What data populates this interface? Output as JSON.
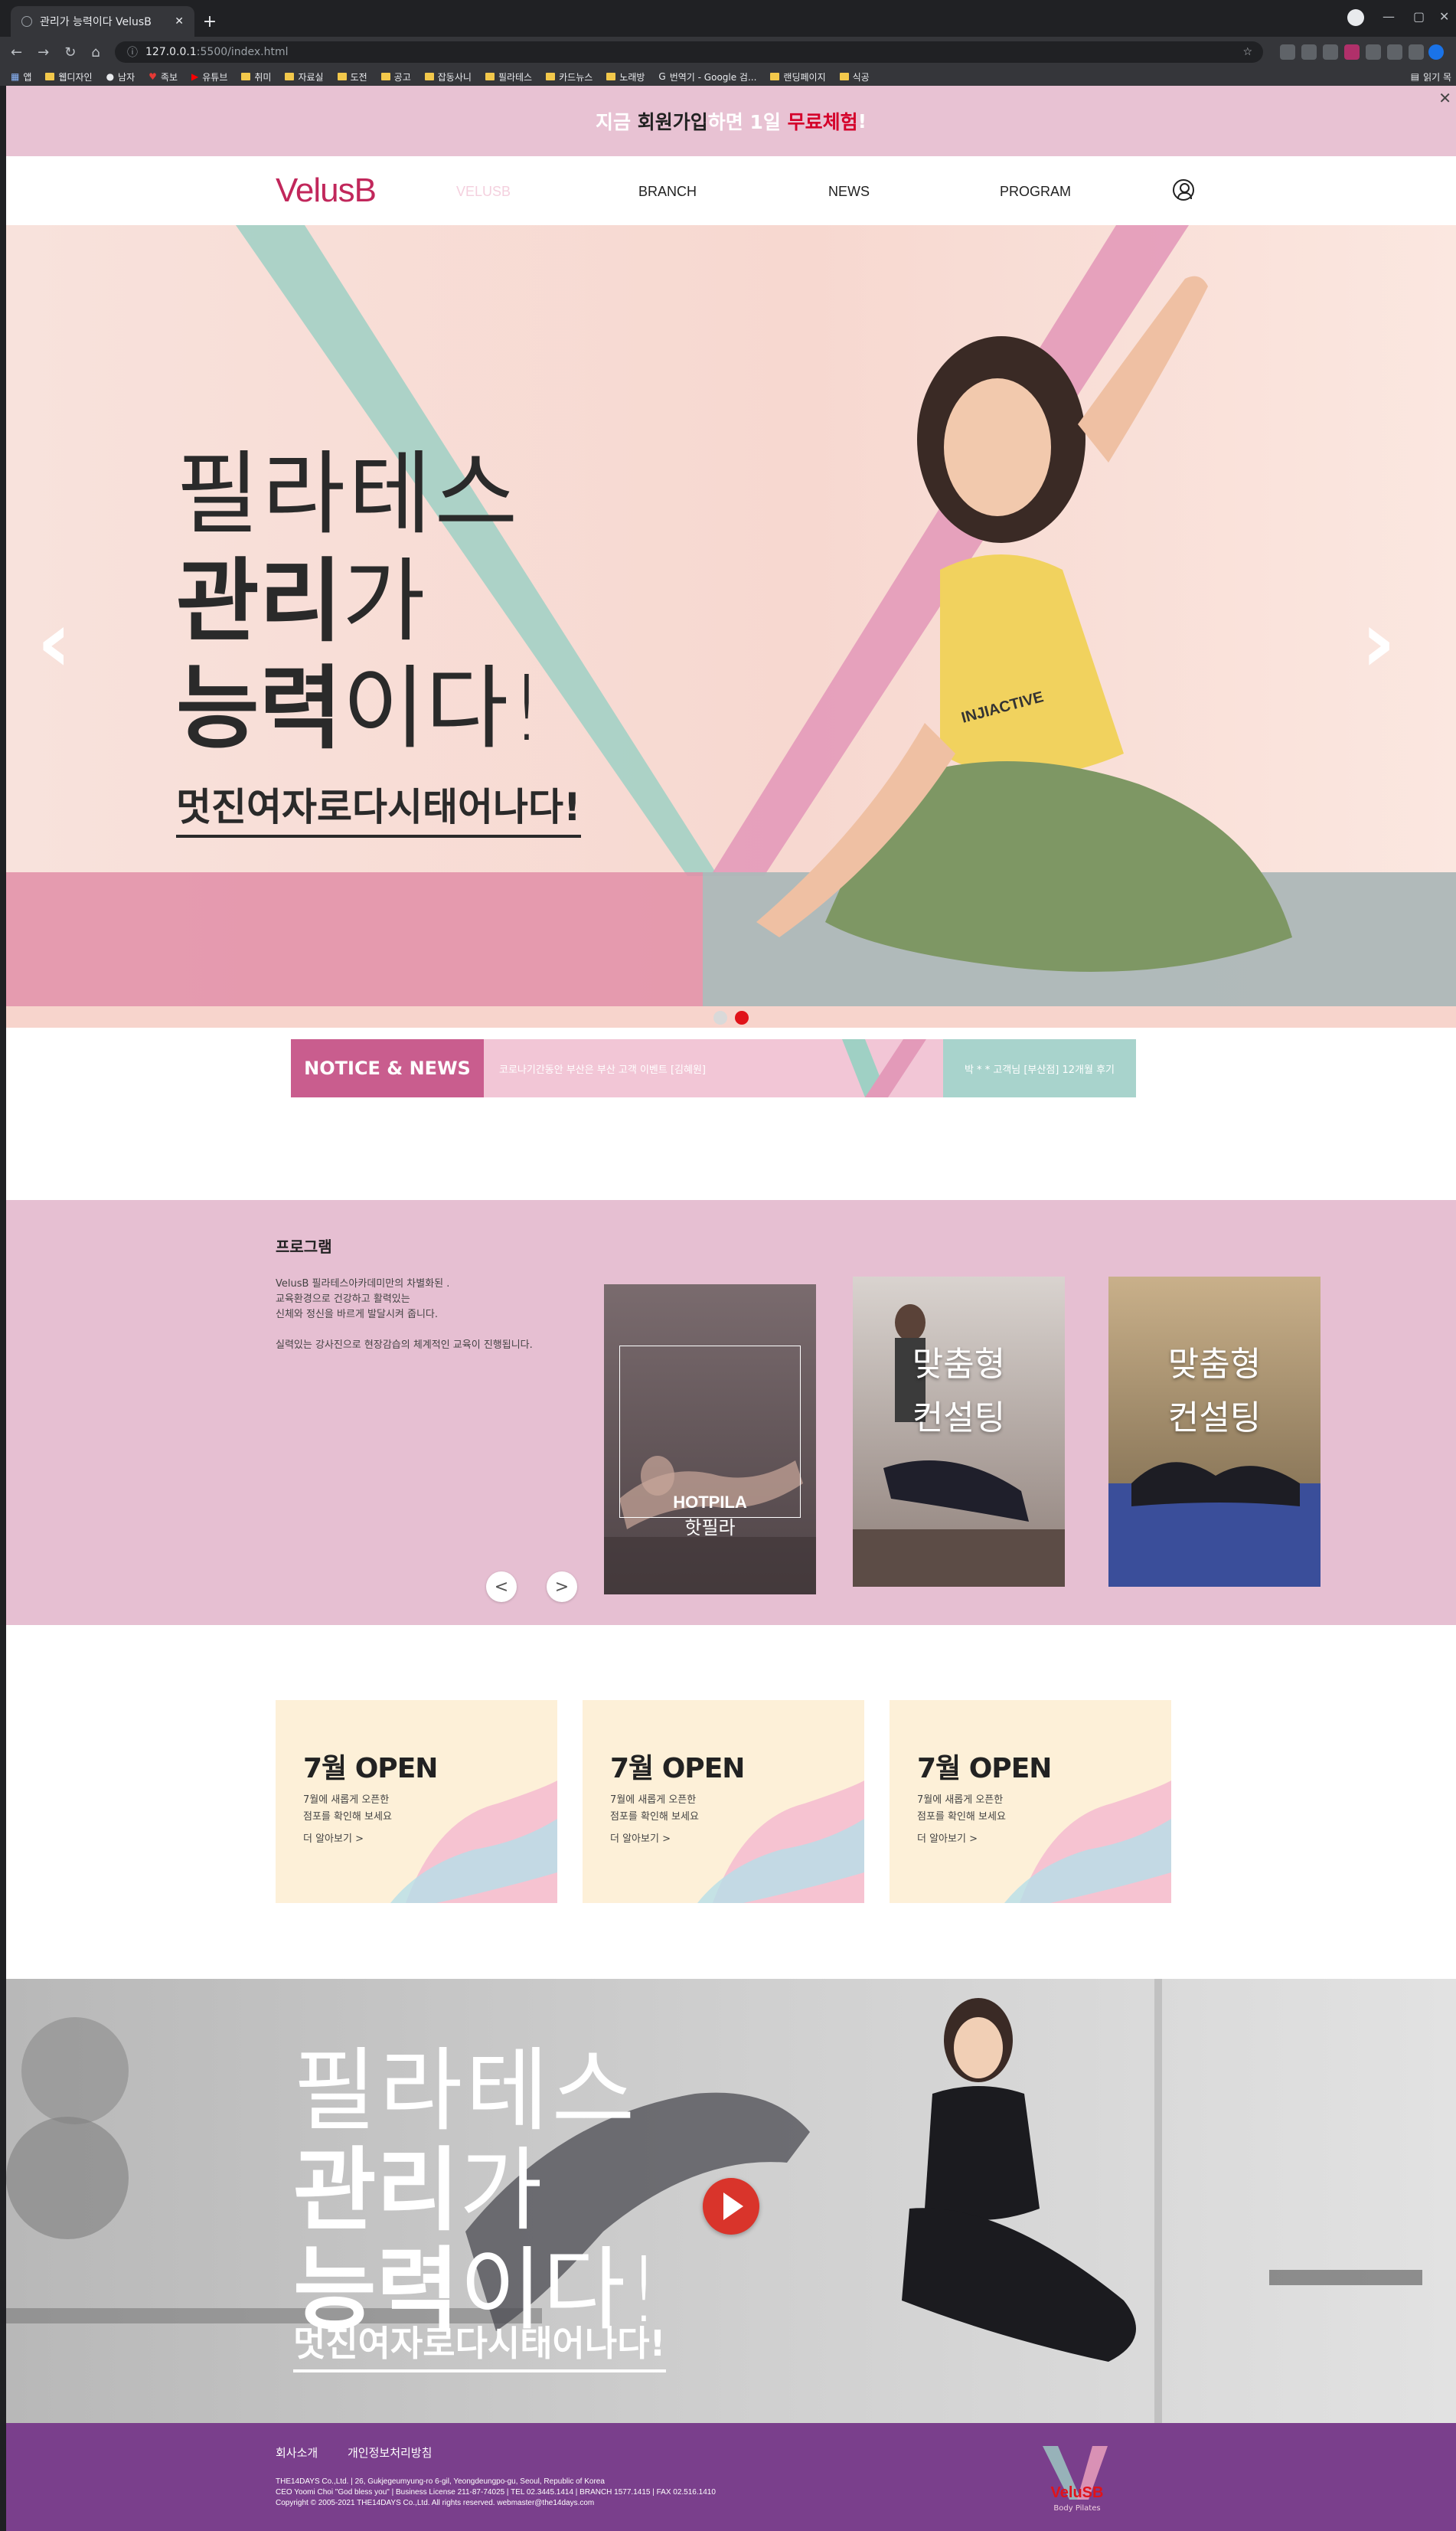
{
  "browser": {
    "tab_title": "관리가 능력이다 VelusB",
    "url_host": "127.0.0.1",
    "url_path": ":5500/index.html",
    "bookmarks": [
      "앱",
      "웹디자인",
      "남자",
      "족보",
      "유튜브",
      "취미",
      "자료실",
      "도전",
      "공고",
      "잡동사니",
      "필라테스",
      "카드뉴스",
      "노래방",
      "번역기 - Google 검...",
      "랜딩페이지",
      "식공"
    ],
    "reading_list": "읽기 목"
  },
  "banner": {
    "part1": "지금 ",
    "part2": "회원가입",
    "part3": "하면 1일 ",
    "part4": "무료체험",
    "part5": "!"
  },
  "header": {
    "logo_text": "VelusB",
    "nav": [
      "VELUSB",
      "BRANCH",
      "NEWS",
      "PROGRAM"
    ]
  },
  "hero": {
    "line1": "필라테스",
    "line2_bold": "관리",
    "line2_rest": "가",
    "line3_bold": "능력",
    "line3_rest": "이다!",
    "subline": "멋진여자로다시태어나다!",
    "shirt_text": "INJIACTIVE",
    "prev_arrow": "‹",
    "next_arrow": "›"
  },
  "notice": {
    "label": "NOTICE & NEWS",
    "item1": "코로나기간동안 부산은 부산 고객 이벤트 [김혜원]",
    "item2": "박 * * 고객님 [부산점] 12개월 후기"
  },
  "program": {
    "title": "프로그램",
    "description": "VelusB 필라테스아카데미만의 차별화된 .\n교육환경으로 건강하고 활력있는\n신체와 정신을 바르게 발달시켜 줍니다.\n\n실력있는 강사진으로 현장감습의 체계적인 교육이 진행됩니다.",
    "cards": [
      {
        "title_en": "HOTPILA",
        "title_kr": "핫필라"
      },
      {
        "line1": "맞춤형",
        "line2": "컨설팅"
      },
      {
        "line1": "맞춤형",
        "line2": "컨설팅"
      }
    ],
    "prev_label": "<",
    "next_label": ">"
  },
  "open_cards": [
    {
      "title": "7월 OPEN",
      "desc": "7월에 새롭게 오픈한\n점포를 확인해 보세요",
      "more": "더 알아보기 >"
    },
    {
      "title": "7월 OPEN",
      "desc": "7월에 새롭게 오픈한\n점포를 확인해 보세요",
      "more": "더 알아보기 >"
    },
    {
      "title": "7월 OPEN",
      "desc": "7월에 새롭게 오픈한\n점포를 확인해 보세요",
      "more": "더 알아보기 >"
    }
  ],
  "video": {
    "line1": "필라테스",
    "line2_bold": "관리",
    "line2_rest": "가",
    "line3_bold": "능력",
    "line3_rest": "이다!",
    "subline": "멋진여자로다시태어나다!"
  },
  "footer": {
    "link1": "회사소개",
    "link2": "개인정보처리방침",
    "info": "THE14DAYS Co.,Ltd. | 26, Gukjegeumyung-ro 6-gil, Yeongdeungpo-gu, Seoul, Republic of Korea\nCEO Yoomi Choi \"God bless you\" | Business License 211-87-74025 | TEL 02.3445.1414 | BRANCH 1577.1415 | FAX 02.516.1410\nCopyright © 2005-2021 THE14DAYS Co.,Ltd. All rights reserved.  webmaster@the14days.com",
    "logo_text": "VeluSB",
    "logo_sub": "Body Pilates"
  },
  "colors": {
    "brand_pink": "#c95d8e",
    "banner_pink": "#e8c2d3",
    "mint": "#a8d3cc",
    "footer_purple": "#7a3f8c",
    "highlight_red": "#d4002a"
  }
}
